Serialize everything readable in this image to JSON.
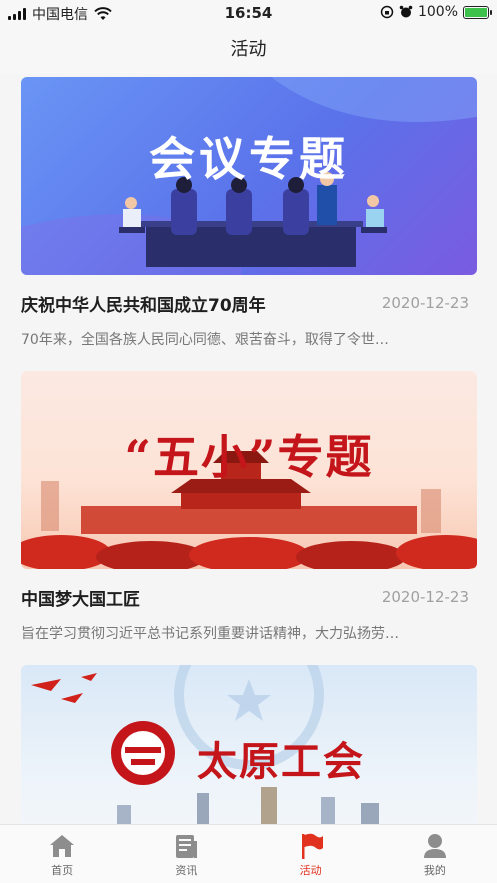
{
  "status_bar": {
    "carrier": "中国电信",
    "time": "16:54",
    "battery": "100%"
  },
  "nav": {
    "title": "活动"
  },
  "cards": [
    {
      "banner_text": "会议专题",
      "title": "庆祝中华人民共和国成立70周年",
      "date": "2020-12-23",
      "summary": "70年来，全国各族人民同心同德、艰苦奋斗，取得了令世…"
    },
    {
      "banner_text": "“五小”专题",
      "title": "中国梦大国工匠",
      "date": "2020-12-23",
      "summary": "旨在学习贯彻习近平总书记系列重要讲话精神，大力弘扬劳…"
    },
    {
      "banner_text": "太原工会"
    }
  ],
  "tabs": [
    {
      "label": "首页",
      "icon": "home-icon",
      "active": false
    },
    {
      "label": "资讯",
      "icon": "news-icon",
      "active": false
    },
    {
      "label": "活动",
      "icon": "flag-icon",
      "active": true
    },
    {
      "label": "我的",
      "icon": "user-icon",
      "active": false
    }
  ],
  "colors": {
    "accent": "#e0321f",
    "tab_inactive": "#666666",
    "banner_red": "#c3151a"
  }
}
